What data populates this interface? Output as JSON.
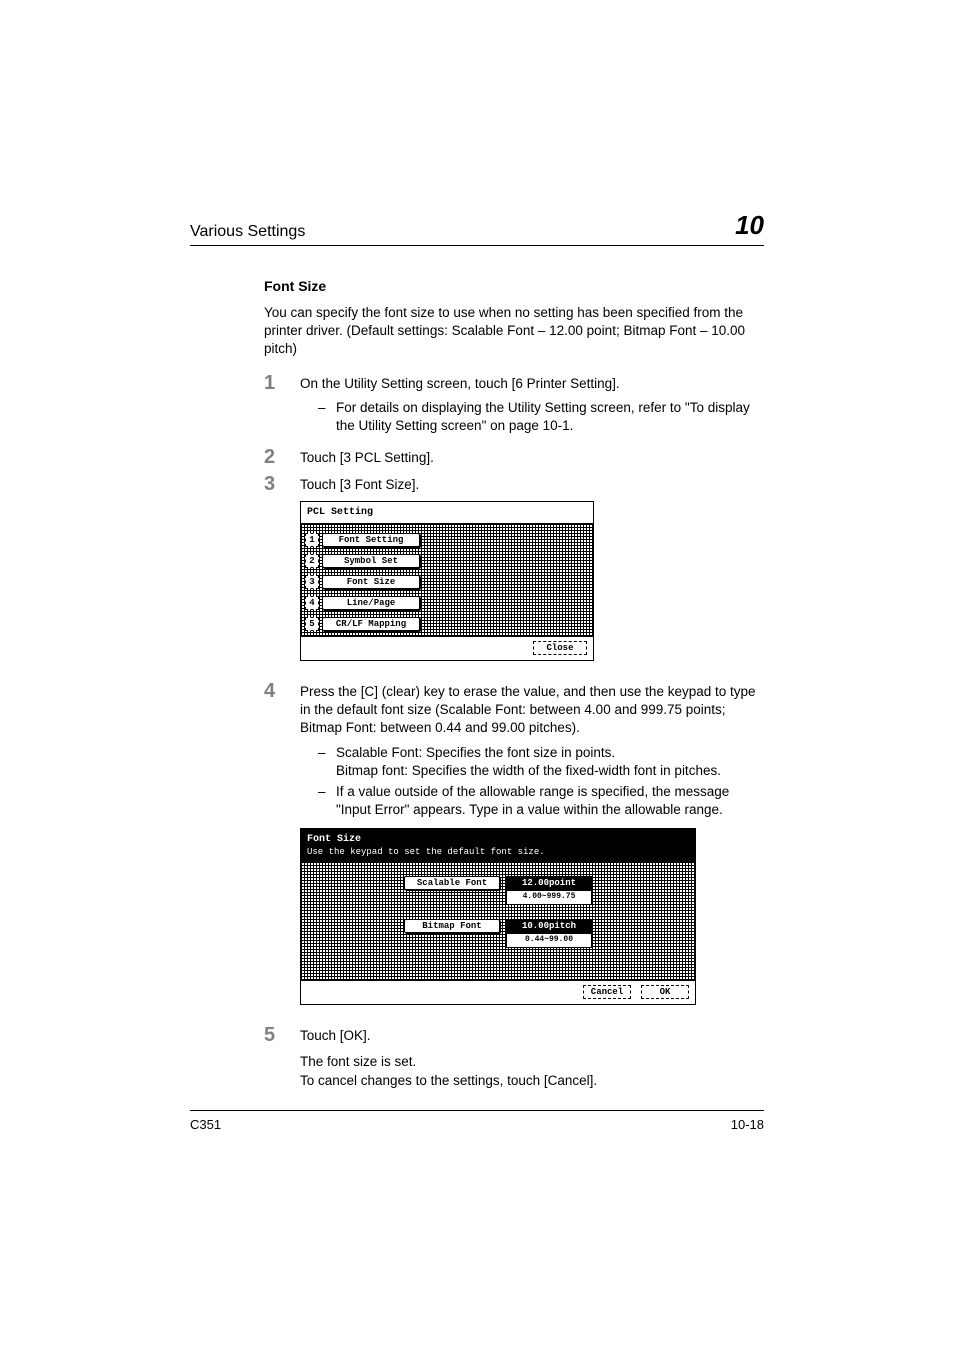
{
  "header": {
    "running_title": "Various Settings",
    "chapter_number": "10"
  },
  "section": {
    "title": "Font Size",
    "intro": "You can specify the font size to use when no setting has been specified from the printer driver. (Default settings: Scalable Font – 12.00 point; Bitmap Font – 10.00 pitch)"
  },
  "steps": {
    "s1": {
      "num": "1",
      "text": "On the Utility Setting screen, touch [6 Printer Setting].",
      "sub1": "For details on displaying the Utility Setting screen, refer to \"To display the Utility Setting screen\" on page 10-1."
    },
    "s2": {
      "num": "2",
      "text": "Touch [3 PCL Setting]."
    },
    "s3": {
      "num": "3",
      "text": "Touch [3 Font Size]."
    },
    "s4": {
      "num": "4",
      "text": "Press the [C] (clear) key to erase the value, and then use the keypad to type in the default font size (Scalable Font: between 4.00 and 999.75 points; Bitmap Font: between 0.44 and 99.00 pitches).",
      "sub1": "Scalable Font: Specifies the font size in points.\nBitmap font: Specifies the width of the fixed-width font in pitches.",
      "sub2": "If a value outside of the allowable range is specified, the message \"Input Error\" appears. Type in a value within the allowable range."
    },
    "s5": {
      "num": "5",
      "text": "Touch [OK].",
      "para1": "The font size is set.",
      "para2": "To cancel changes to the settings, touch [Cancel]."
    }
  },
  "screen1": {
    "title": "PCL Setting",
    "items": {
      "i1n": "1",
      "i1": "Font Setting",
      "i2n": "2",
      "i2": "Symbol Set",
      "i3n": "3",
      "i3": "Font Size",
      "i4n": "4",
      "i4": "Line/Page",
      "i5n": "5",
      "i5": "CR/LF Mapping"
    },
    "close": "Close"
  },
  "screen2": {
    "title": "Font Size",
    "subtitle": "Use the keypad to set the default font size.",
    "scalable_label": "Scalable Font",
    "scalable_value": "12.00point",
    "scalable_range": "4.00~999.75",
    "bitmap_label": "Bitmap Font",
    "bitmap_value": "10.00pitch",
    "bitmap_range": "0.44~99.00",
    "cancel": "Cancel",
    "ok": "OK"
  },
  "footer": {
    "model": "C351",
    "page": "10-18"
  }
}
